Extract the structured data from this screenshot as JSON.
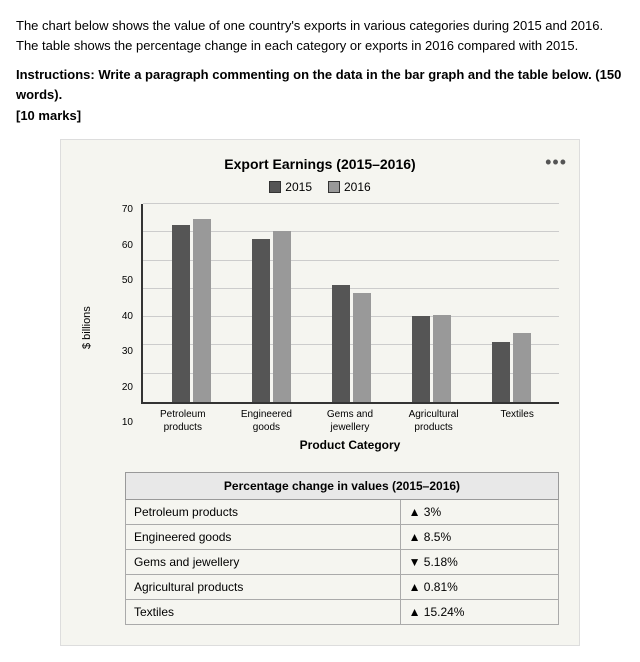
{
  "intro": {
    "text": "The chart below shows the value of one country's exports in various categories during 2015 and 2016. The table shows the percentage change in each category or exports in 2016 compared with 2015.",
    "instructions": "Instructions: Write a paragraph commenting on the data in the bar graph and the table below. (150 words).",
    "marks": "[10 marks]"
  },
  "chart": {
    "title": "Export Earnings (2015–2016)",
    "legend": {
      "label_2015": "2015",
      "label_2016": "2016"
    },
    "y_axis_label": "$ billions",
    "y_ticks": [
      "10",
      "20",
      "30",
      "40",
      "50",
      "60",
      "70"
    ],
    "x_axis_title": "Product Category",
    "categories": [
      {
        "name": "Petroleum\nproducts",
        "val_2015": 62,
        "val_2016": 64
      },
      {
        "name": "Engineered\ngoods",
        "val_2015": 57,
        "val_2016": 60
      },
      {
        "name": "Gems and\njewellery",
        "val_2015": 41,
        "val_2016": 38
      },
      {
        "name": "Agricultural\nproducts",
        "val_2015": 30,
        "val_2016": 30.5
      },
      {
        "name": "Textiles",
        "val_2015": 21,
        "val_2016": 24
      }
    ],
    "max_val": 70
  },
  "table": {
    "header": "Percentage change in values (2015–2016)",
    "rows": [
      {
        "category": "Petroleum products",
        "direction": "up",
        "change": "3%"
      },
      {
        "category": "Engineered goods",
        "direction": "up",
        "change": "8.5%"
      },
      {
        "category": "Gems and jewellery",
        "direction": "down",
        "change": "5.18%"
      },
      {
        "category": "Agricultural products",
        "direction": "up",
        "change": "0.81%"
      },
      {
        "category": "Textiles",
        "direction": "up",
        "change": "15.24%"
      }
    ]
  },
  "more_icon": "•••"
}
